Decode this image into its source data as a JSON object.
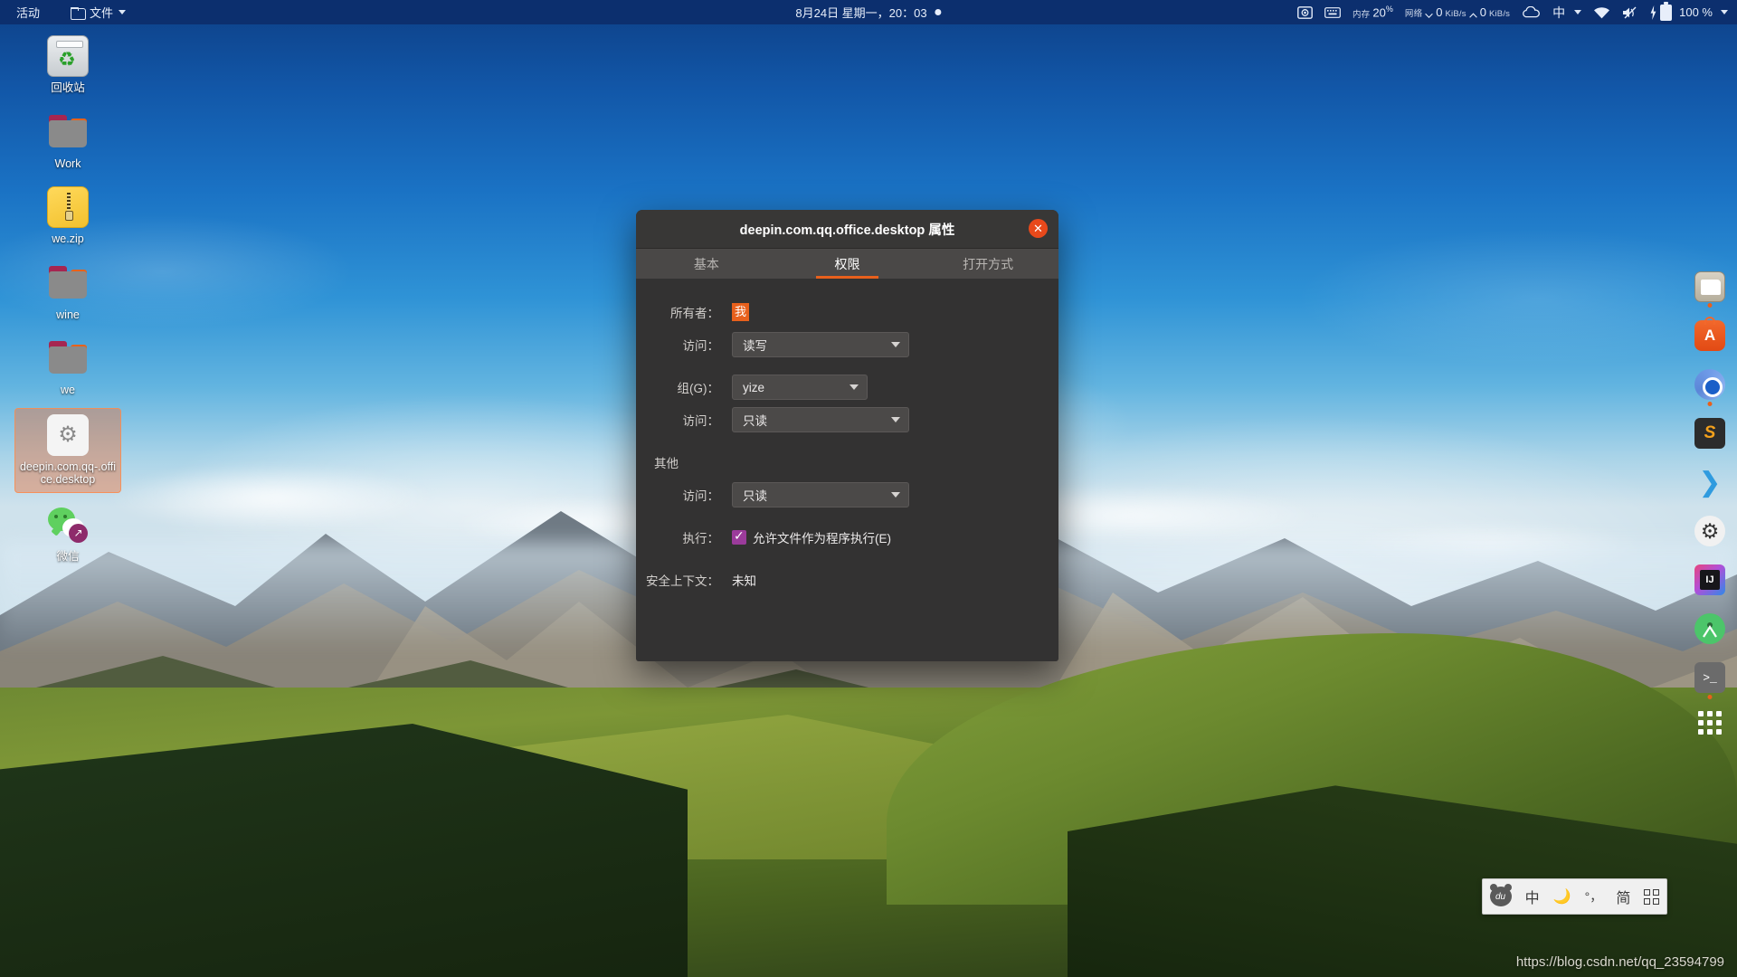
{
  "top_panel": {
    "activities_label": "活动",
    "app_menu_label": "文件",
    "app_menu_icon": "folder-icon",
    "caret_icon": "chevron-down-icon",
    "datetime": "8月24日 星期一，20：03",
    "notification_dot_icon": "dot-icon",
    "indicators": {
      "screenshot_icon": "camera-icon",
      "keyboard_icon": "keyboard-icon",
      "memory_label": "内存",
      "memory_value": "20",
      "memory_unit": "%",
      "network_label": "网络",
      "download_value": "0",
      "download_unit": "KiB/s",
      "download_icon": "chevron-down-icon",
      "upload_value": "0",
      "upload_unit": "KiB/s",
      "upload_icon": "chevron-up-icon",
      "cloud_icon": "cloud-icon",
      "ime_label": "中",
      "ime_caret_icon": "chevron-down-icon",
      "wifi_icon": "wifi-icon",
      "volume_icon": "volume-muted-icon",
      "battery_icon": "battery-charging-icon",
      "battery_label": "100 %",
      "battery_caret_icon": "chevron-down-icon"
    }
  },
  "desktop_icons": [
    {
      "label": "回收站",
      "icon": "trash-icon",
      "selected": false
    },
    {
      "label": "Work",
      "icon": "folder-icon",
      "selected": false
    },
    {
      "label": "we.zip",
      "icon": "zip-archive-icon",
      "selected": false
    },
    {
      "label": "wine",
      "icon": "folder-icon",
      "selected": false
    },
    {
      "label": "we",
      "icon": "folder-icon",
      "selected": false
    },
    {
      "label": "deepin.com.qq-.office.desktop",
      "icon": "desktop-entry-gear-icon",
      "selected": true
    },
    {
      "label": "微信",
      "icon": "wechat-shortcut-icon",
      "selected": false
    }
  ],
  "right_dock": [
    {
      "name": "files",
      "icon": "file-manager-icon",
      "running": true
    },
    {
      "name": "app-store",
      "icon": "app-store-icon",
      "running": false
    },
    {
      "name": "chromium",
      "icon": "chromium-icon",
      "running": true
    },
    {
      "name": "sublime-text",
      "icon": "sublime-text-icon",
      "running": false
    },
    {
      "name": "vs-code",
      "icon": "vscode-icon",
      "running": false
    },
    {
      "name": "settings",
      "icon": "gear-icon",
      "running": false
    },
    {
      "name": "intellij-idea",
      "icon": "intellij-idea-icon",
      "running": false
    },
    {
      "name": "android-studio",
      "icon": "android-studio-icon",
      "running": false
    },
    {
      "name": "terminal",
      "icon": "terminal-icon",
      "running": true
    },
    {
      "name": "show-applications",
      "icon": "grid-apps-icon",
      "running": false
    }
  ],
  "dialog": {
    "title": "deepin.com.qq.office.desktop 属性",
    "close_icon": "close-icon",
    "tabs": [
      {
        "label": "基本",
        "active": false
      },
      {
        "label": "权限",
        "active": true
      },
      {
        "label": "打开方式",
        "active": false
      }
    ],
    "accent_color": "#e8601c",
    "checkbox_color": "#9b3b9b",
    "fields": {
      "owner_label": "所有者：",
      "owner_value": "我",
      "owner_access_label": "访问：",
      "owner_access_value": "读写",
      "group_label": "组(G)：",
      "group_value": "yize",
      "group_access_label": "访问：",
      "group_access_value": "只读",
      "others_label": "其他",
      "others_access_label": "访问：",
      "others_access_value": "只读",
      "execute_label": "执行：",
      "execute_checkbox_label": "允许文件作为程序执行(E)",
      "execute_checked": true,
      "security_context_label": "安全上下文：",
      "security_context_value": "未知"
    },
    "dropdown_arrow_icon": "chevron-down-icon"
  },
  "ime_bar": {
    "logo_icon": "baidu-panda-icon",
    "logo_text": "du",
    "mode_label": "中",
    "theme_icon": "moon-icon",
    "punctuation_label": "°，",
    "script_label": "简",
    "grid_icon": "keyboard-grid-icon"
  },
  "watermark": "https://blog.csdn.net/qq_23594799"
}
